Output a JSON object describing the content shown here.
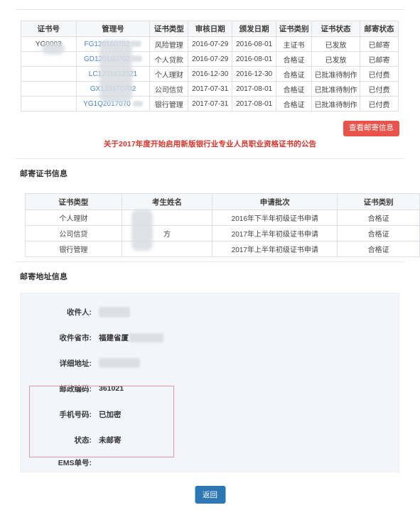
{
  "certificate_table": {
    "headers": [
      "证书号",
      "管理号",
      "证书类型",
      "审核日期",
      "颁发日期",
      "证书类别",
      "证书状态",
      "邮寄状态"
    ],
    "rows": [
      {
        "cert_no": "YG0003",
        "manage_no": "FG120160702",
        "cert_type": "风险管理",
        "review_date": "2016-07-29",
        "issue_date": "2016-08-01",
        "cert_category": "主证书",
        "cert_status": "已发放",
        "mail_status": "已邮寄"
      },
      {
        "cert_no": "",
        "manage_no": "GD120160702",
        "cert_type": "个人贷款",
        "review_date": "2016-07-29",
        "issue_date": "2016-08-01",
        "cert_category": "合格证",
        "cert_status": "已发放",
        "mail_status": "已邮寄"
      },
      {
        "cert_no": "",
        "manage_no": "LC1201612021",
        "cert_type": "个人理财",
        "review_date": "2016-12-30",
        "issue_date": "2016-12-30",
        "cert_category": "合格证",
        "cert_status": "已批准待制作",
        "mail_status": "已付费"
      },
      {
        "cert_no": "",
        "manage_no": "GX120170702",
        "cert_type": "公司信贷",
        "review_date": "2017-07-31",
        "issue_date": "2017-08-01",
        "cert_category": "合格证",
        "cert_status": "已批准待制作",
        "mail_status": "已付费"
      },
      {
        "cert_no": "",
        "manage_no": "YG1Q2017070",
        "cert_type": "银行管理",
        "review_date": "2017-07-31",
        "issue_date": "2017-08-01",
        "cert_category": "合格证",
        "cert_status": "已批准待制作",
        "mail_status": "已付费"
      }
    ]
  },
  "actions": {
    "view_mail_info": "查看邮寄信息",
    "back": "返回"
  },
  "announcement": {
    "text": "关于2017年度开始启用新版银行业专业人员职业资格证书的公告",
    "color": "#d9352c"
  },
  "mail_cert_section": {
    "title": "邮寄证书信息",
    "headers": [
      "证书类型",
      "考生姓名",
      "申请批次",
      "证书类别"
    ],
    "rows": [
      {
        "cert_type": "个人理财",
        "candidate_name": "",
        "apply_batch": "2016年下半年初级证书申请",
        "cert_category": "合格证"
      },
      {
        "cert_type": "公司信贷",
        "candidate_name": "方",
        "apply_batch": "2017年上半年初级证书申请",
        "cert_category": "合格证"
      },
      {
        "cert_type": "银行管理",
        "candidate_name": "",
        "apply_batch": "2017年上半年初级证书申请",
        "cert_category": "合格证"
      }
    ]
  },
  "address_section": {
    "title": "邮寄地址信息",
    "fields": [
      {
        "label": "收件人:",
        "value": ""
      },
      {
        "label": "收件省市:",
        "value": "福建省厦"
      },
      {
        "label": "详细地址:",
        "value": ""
      },
      {
        "label": "邮政编码:",
        "value": "361021"
      },
      {
        "label": "手机号码:",
        "value": "已加密"
      },
      {
        "label": "状态:",
        "value": "未邮寄"
      },
      {
        "label": "EMS单号:",
        "value": ""
      }
    ],
    "highlight_border_color": "#e09ba0"
  }
}
